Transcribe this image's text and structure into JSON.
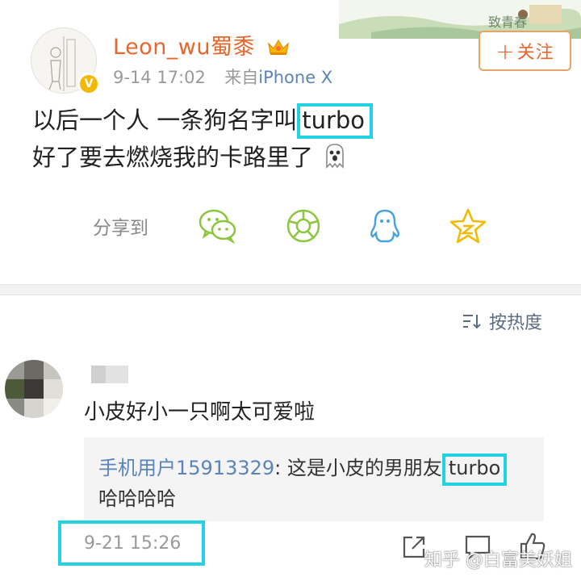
{
  "post": {
    "username": "Leon_wu蜀黍",
    "time": "9-14 17:02",
    "source_prefix": "来自",
    "source": "iPhone X",
    "follow_label": "关注",
    "line1_before": "以后一个人 一条狗名字叫",
    "line1_highlight": "turbo",
    "line2": "好了要去燃烧我的卡路里了",
    "share_label": "分享到",
    "share_targets": [
      "wechat-icon",
      "moments-icon",
      "qq-icon",
      "qzone-icon"
    ],
    "banner_text": "致青春"
  },
  "comments": {
    "sort_label": "按热度",
    "items": [
      {
        "text": "小皮好小一只啊太可爱啦",
        "reply_user": "手机用户15913329",
        "reply_before": ": 这是小皮的男朋友",
        "reply_highlight": "turbo",
        "reply_line2": "哈哈哈哈",
        "time": "9-21 15:26"
      }
    ]
  },
  "watermark": "知乎 @白富美妖姐",
  "colors": {
    "accent_orange": "#e8662a",
    "link_blue": "#5b84b8",
    "highlight_cyan": "#23d2e2",
    "verified_gold": "#f5b800",
    "share_green": "#8cc63f",
    "share_blue": "#4aa3df",
    "share_gold": "#f5b800"
  }
}
